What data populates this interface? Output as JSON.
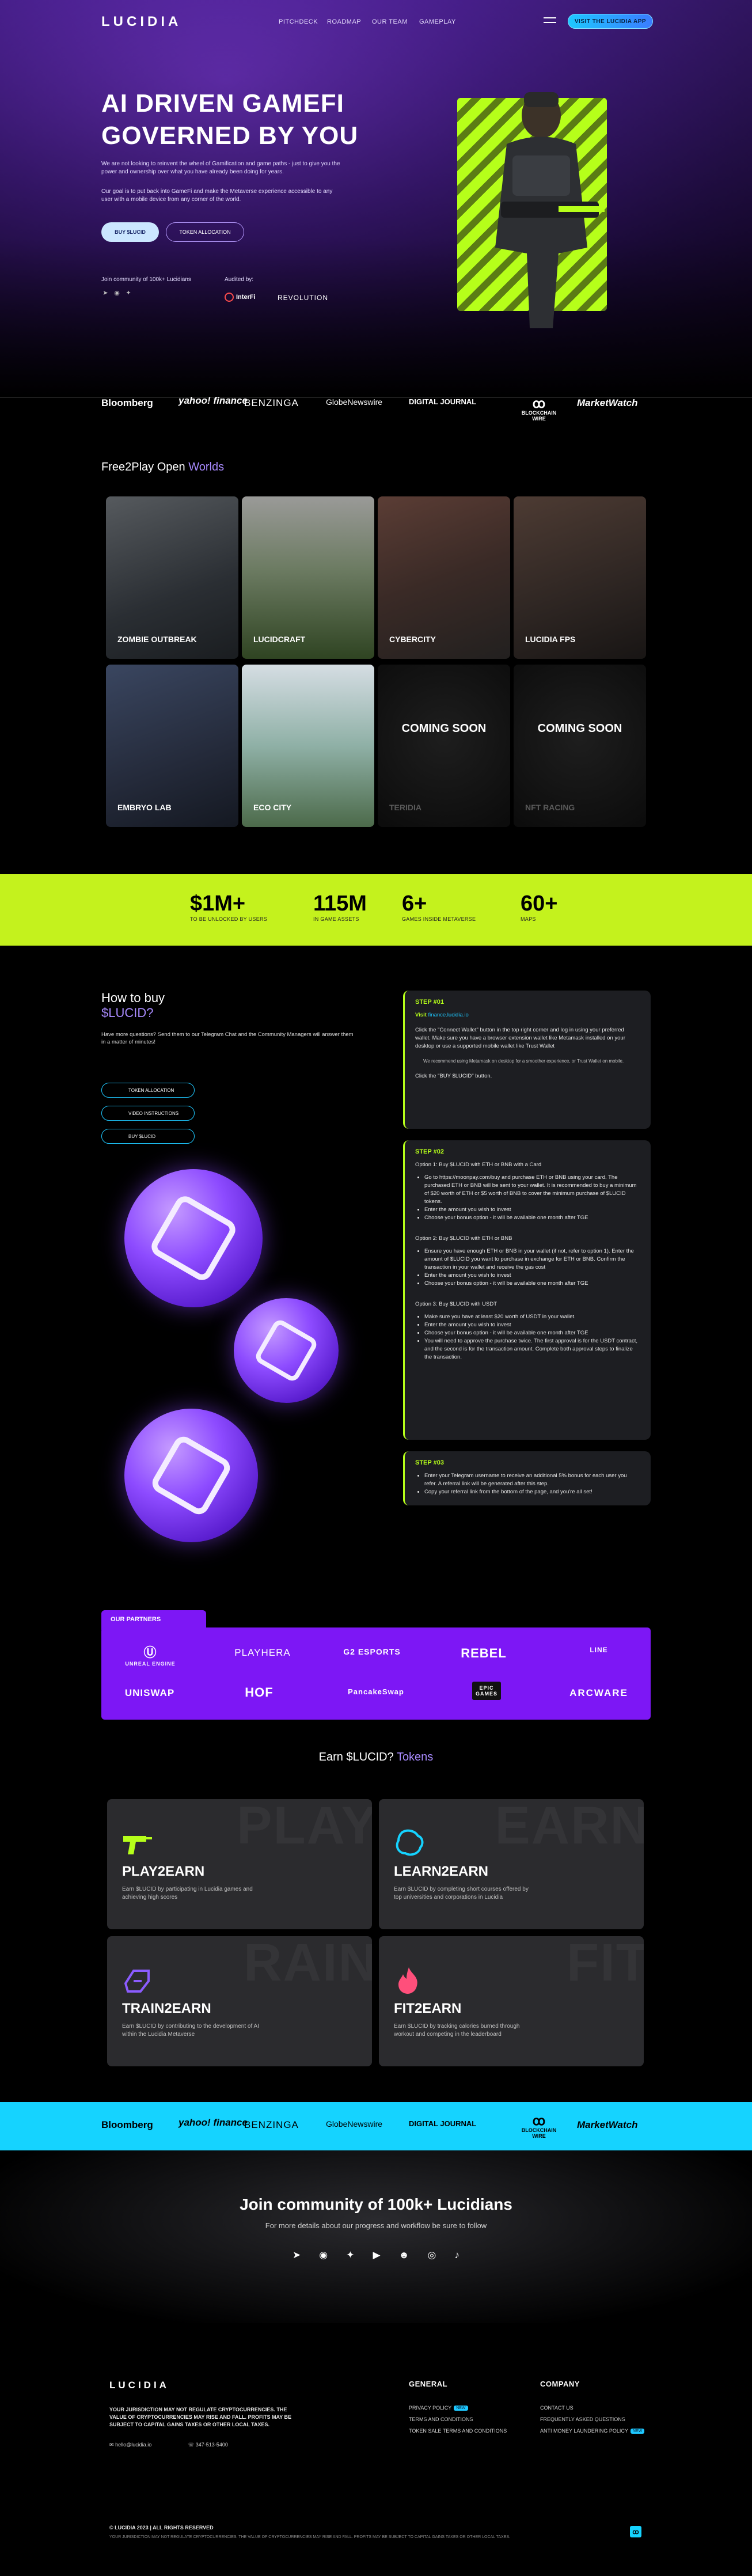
{
  "nav": {
    "logo": "LUCIDIA",
    "links": [
      "PITCHDECK",
      "ROADMAP",
      "OUR TEAM",
      "GAMEPLAY"
    ],
    "cta": "VISIT THE LUCIDIA APP"
  },
  "hero": {
    "title_line1": "AI DRIVEN GAMEFI",
    "title_line2": "GOVERNED BY YOU",
    "para1": "We are not looking to reinvent the wheel of Gamification and game paths - just to give you the power and ownership over what you have already been doing for years.",
    "para2": "Our goal is to put back into GameFi and make the Metaverse experience accessible to any user with a mobile device from any corner of the world.",
    "btn_buy": "BUY $LUCID",
    "btn_alloc": "TOKEN ALLOCATION",
    "join_text": "Join community of 100k+ Lucidians",
    "audited_by": "Audited by:",
    "auditor1": "InterFi",
    "auditor2": "REVOLUTION"
  },
  "press": [
    "Bloomberg",
    "yahoo! finance",
    "BENZINGA",
    "GlobeNewswire",
    "DIGITAL JOURNAL",
    "BLOCKCHAIN WIRE",
    "MarketWatch"
  ],
  "worlds": {
    "title_a": "Free2Play Open ",
    "title_b": "Worlds",
    "tiles": [
      {
        "label": "ZOMBIE OUTBREAK"
      },
      {
        "label": "LUCIDCRAFT"
      },
      {
        "label": "CYBERCITY"
      },
      {
        "label": "LUCIDIA FPS"
      },
      {
        "label": "EMBRYO LAB"
      },
      {
        "label": "ECO CITY"
      },
      {
        "label": "TERIDIA",
        "soon": "COMING SOON"
      },
      {
        "label": "NFT RACING",
        "soon": "COMING SOON"
      }
    ]
  },
  "stats": [
    {
      "value": "$1M+",
      "label": "TO BE UNLOCKED BY USERS"
    },
    {
      "value": "115M",
      "label": "IN GAME ASSETS"
    },
    {
      "value": "6+",
      "label": "GAMES INSIDE METAVERSE"
    },
    {
      "value": "60+",
      "label": "MAPS"
    }
  ],
  "how": {
    "title_line1": "How to buy",
    "title_line2": "$LUCID?",
    "intro": "Have more questions? Send them to our Telegram Chat and the Community Managers will answer them in a matter of minutes!",
    "buttons": [
      "TOKEN ALLOCATION",
      "VIDEO INSTRUCTIONS",
      "BUY $LUCID"
    ],
    "step1": {
      "head": "STEP #01",
      "visit": "Visit",
      "link": "finance.lucidia.io",
      "p1": "Click the \"Connect Wallet\" button in the top right corner and log in using your preferred wallet. Make sure you have a browser extension wallet like Metamask installed on your desktop or use a supported mobile wallet like Trust Wallet",
      "note": "We recommend using Metamask on desktop for a smoother experience, or Trust Wallet on mobile.",
      "p2": "Click the \"BUY $LUCID\" button."
    },
    "step2": {
      "head": "STEP #02",
      "o1_title": "Option 1: Buy $LUCID with ETH or BNB with a Card",
      "o1_items": [
        "Go to https://moonpay.com/buy and purchase ETH or BNB using your card. The purchased ETH or BNB will be sent to your wallet. It is recommended to buy a minimum of $20 worth of ETH or $5 worth of BNB to cover the minimum purchase of $LUCID tokens.",
        "Enter the amount you wish to invest",
        "Choose your bonus option - it will be available one month after TGE"
      ],
      "o2_title": "Option 2: Buy $LUCID with ETH or BNB",
      "o2_items": [
        "Ensure you have enough ETH or BNB in your wallet (if not, refer to option 1). Enter the amount of $LUCID you want to purchase in exchange for ETH or BNB. Confirm the transaction in your wallet and receive the gas cost",
        "Enter the amount you wish to invest",
        "Choose your bonus option - it will be available one month after TGE"
      ],
      "o3_title": "Option 3: Buy $LUCID with USDT",
      "o3_items": [
        "Make sure you have at least $20 worth of USDT in your wallet.",
        "Enter the amount you wish to invest",
        "Choose your bonus option - it will be available one month after TGE",
        "You will need to approve the purchase twice. The first approval is for the USDT contract, and the second is for the transaction amount. Complete both approval steps to finalize the transaction."
      ]
    },
    "step3": {
      "head": "STEP #03",
      "items": [
        "Enter your Telegram username to receive an additional 5% bonus for each user you refer. A referral link will be generated after this step.",
        "Copy your referral link from the bottom of the page, and you're all set!"
      ]
    }
  },
  "partners": {
    "tab": "OUR PARTNERS",
    "row1": [
      "UNREAL ENGINE",
      "PLAYHERA",
      "G2 ESPORTS",
      "REBEL",
      "LINE"
    ],
    "row2": [
      "UNISWAP",
      "HOF",
      "PancakeSwap",
      "EPIC GAMES",
      "ARCWARE"
    ]
  },
  "earn": {
    "title_a": "Earn $LUCID? ",
    "title_b": "Tokens",
    "cards": [
      {
        "ghost": "PLAY",
        "title": "PLAY2EARN",
        "desc": "Earn $LUCID by participating in Lucidia games and achieving high scores"
      },
      {
        "ghost": "EARN",
        "title": "LEARN2EARN",
        "desc": "Earn $LUCID by completing short courses offered by top universities and corporations in Lucidia"
      },
      {
        "ghost": "RAIN",
        "title": "TRAIN2EARN",
        "desc": "Earn $LUCID by contributing to the development of AI within the Lucidia Metaverse"
      },
      {
        "ghost": "FIT",
        "title": "FIT2EARN",
        "desc": "Earn $LUCID by tracking calories burned through workout and competing in the leaderboard"
      }
    ]
  },
  "community": {
    "title": "Join community of 100k+ Lucidians",
    "subtitle": "For more details about our progress and workflow be sure to follow"
  },
  "footer": {
    "logo": "LUCIDIA",
    "disclaimer": "YOUR JURISDICTION MAY NOT REGULATE CRYPTOCURRENCIES. THE VALUE OF CRYPTOCURRENCIES MAY RISE AND FALL. PROFITS MAY BE SUBJECT TO CAPITAL GAINS TAXES OR OTHER LOCAL TAXES.",
    "email": "hello@lucidia.io",
    "phone": "347-513-5400",
    "general_head": "GENERAL",
    "general_links": [
      "PRIVACY POLICY",
      "TERMS AND CONDITIONS",
      "TOKEN SALE TERMS AND CONDITIONS"
    ],
    "new_badge": "NEW",
    "company_head": "COMPANY",
    "company_links": [
      "CONTACT US",
      "FREQUENTLY ASKED QUESTIONS",
      "ANTI MONEY LAUNDERING POLICY"
    ],
    "copyright": "© LUCIDIA 2023 | ALL RIGHTS RESERVED",
    "fine": "YOUR JURISDICTION MAY NOT REGULATE CRYPTOCURRENCIES. THE VALUE OF CRYPTOCURRENCIES MAY RISE AND FALL. PROFITS MAY BE SUBJECT TO CAPITAL GAINS TAXES OR OTHER LOCAL TAXES."
  },
  "colors": {
    "lime": "#b6ff1a",
    "cyan": "#15d3ff",
    "purple": "#7d17f5"
  }
}
